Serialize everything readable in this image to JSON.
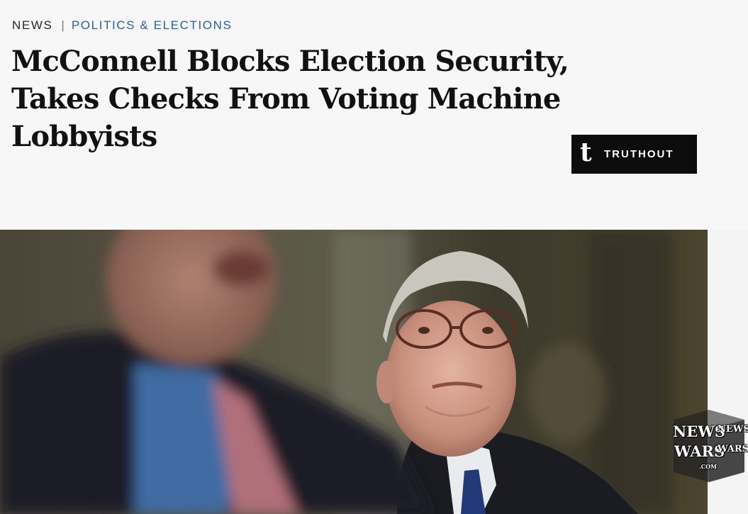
{
  "article": {
    "section": "NEWS",
    "divider": "|",
    "category": "POLITICS & ELECTIONS",
    "headline": "McConnell Blocks Election Security, Takes Checks From Voting Machine Lobbyists"
  },
  "brand": {
    "logo_letter": "t",
    "name": "TRUTHOUT"
  },
  "photo": {
    "icon": "news-photo"
  },
  "watermark": {
    "line1": "NEWS",
    "line2": "WARS",
    "small": ".COM"
  },
  "colors": {
    "category_link": "#2f5fa7",
    "headline": "#111111",
    "brand_bg": "#0c0c0c",
    "page_bg": "#f7f7f7"
  }
}
